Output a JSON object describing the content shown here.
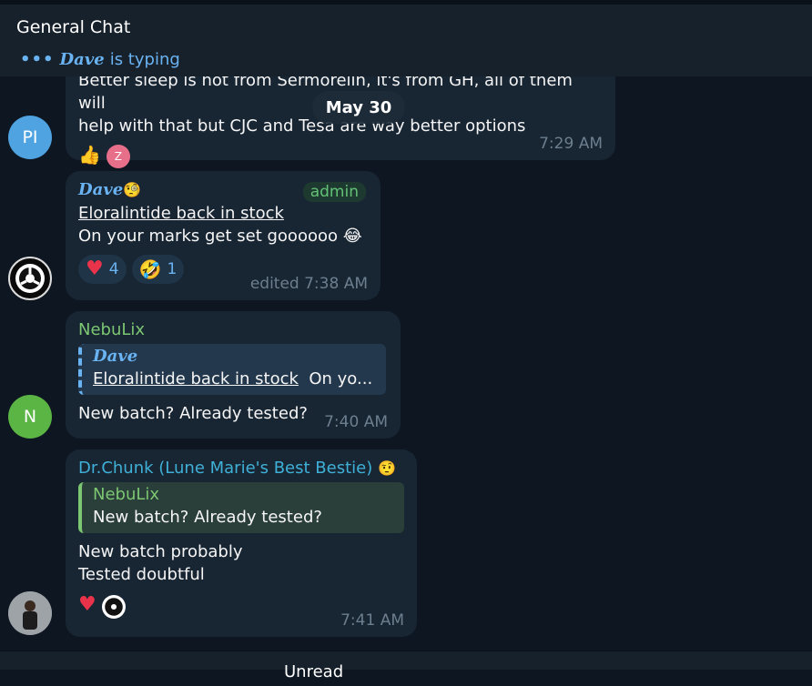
{
  "header": {
    "title": "General Chat",
    "typing_dots": "•••",
    "typing_name": "Dave",
    "typing_suffix": "is typing"
  },
  "date_separator": "May 30",
  "messages": [
    {
      "avatar_initials": "PI",
      "avatar_color": "#4fa3e0",
      "text_line1": "Better sleep is not from Sermorelin, it's from GH, all of them will",
      "text_line2": "help with that but CJC and Tesa are way better options",
      "reaction_emoji": "👍",
      "reaction_avatar": "Z",
      "reaction_avatar_color": "#e86f8a",
      "time": "7:29 AM"
    },
    {
      "sender": "Dave",
      "sender_emoji": "🧐",
      "badge": "admin",
      "title_link": "Eloralintide back in stock",
      "text": "On your marks get set goooooo 😂",
      "reactions": [
        {
          "emoji": "♥",
          "count": "4"
        },
        {
          "emoji": "🤣",
          "count": "1"
        }
      ],
      "time": "edited 7:38 AM"
    },
    {
      "sender": "NebuLix",
      "sender_color": "#7cc772",
      "avatar_initials": "N",
      "avatar_color": "#5bb544",
      "quote_name": "Dave",
      "quote_link": "Eloralintide back in stock",
      "quote_text": "On yo...",
      "text": "New batch? Already tested?",
      "time": "7:40 AM"
    },
    {
      "sender": "Dr.Chunk (Lune Marie's Best Bestie)",
      "sender_color": "#3fb0d8",
      "sender_emoji": "🤨",
      "quote_name": "NebuLix",
      "quote_text": "New batch? Already tested?",
      "text_line1": "New batch probably",
      "text_line2": "Tested doubtful",
      "reaction_emoji": "♥",
      "time": "7:41 AM"
    }
  ],
  "bottom": {
    "text": "Unread"
  }
}
